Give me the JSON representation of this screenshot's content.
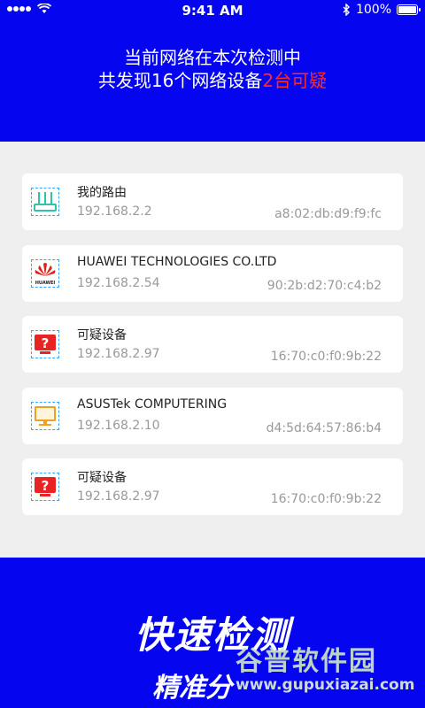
{
  "status": {
    "time": "9:41 AM",
    "battery": "100%"
  },
  "header": {
    "line1": "当前网络在本次检测中",
    "line2_prefix": "共发现16个网络设备",
    "line2_highlight": "2台可疑"
  },
  "devices": [
    {
      "icon": "router-icon",
      "name": "我的路由",
      "ip": "192.168.2.2",
      "mac": "a8:02:db:d9:f9:fc"
    },
    {
      "icon": "huawei-logo-icon",
      "name": "HUAWEI TECHNOLOGIES CO.LTD",
      "ip": "192.168.2.54",
      "mac": "90:2b:d2:70:c4:b2",
      "logo_text": "HUAWEI"
    },
    {
      "icon": "suspicious-device-icon",
      "name": "可疑设备",
      "ip": "192.168.2.97",
      "mac": "16:70:c0:f0:9b:22"
    },
    {
      "icon": "monitor-icon",
      "name": "ASUSTek COMPUTERING",
      "ip": "192.168.2.10",
      "mac": "d4:5d:64:57:86:b4"
    },
    {
      "icon": "suspicious-device-icon",
      "name": "可疑设备",
      "ip": "192.168.2.97",
      "mac": "16:70:c0:f0:9b:22"
    }
  ],
  "footer": {
    "slogan1": "快速检测",
    "slogan2": "精准分"
  },
  "watermark": {
    "title": "谷普软件园",
    "url": "www.gupuxiazai.com"
  },
  "colors": {
    "primary": "#0505f0",
    "highlight": "#ff2a2a",
    "router": "#2ec4a7",
    "alert": "#e82323",
    "monitor": "#f0a020"
  }
}
